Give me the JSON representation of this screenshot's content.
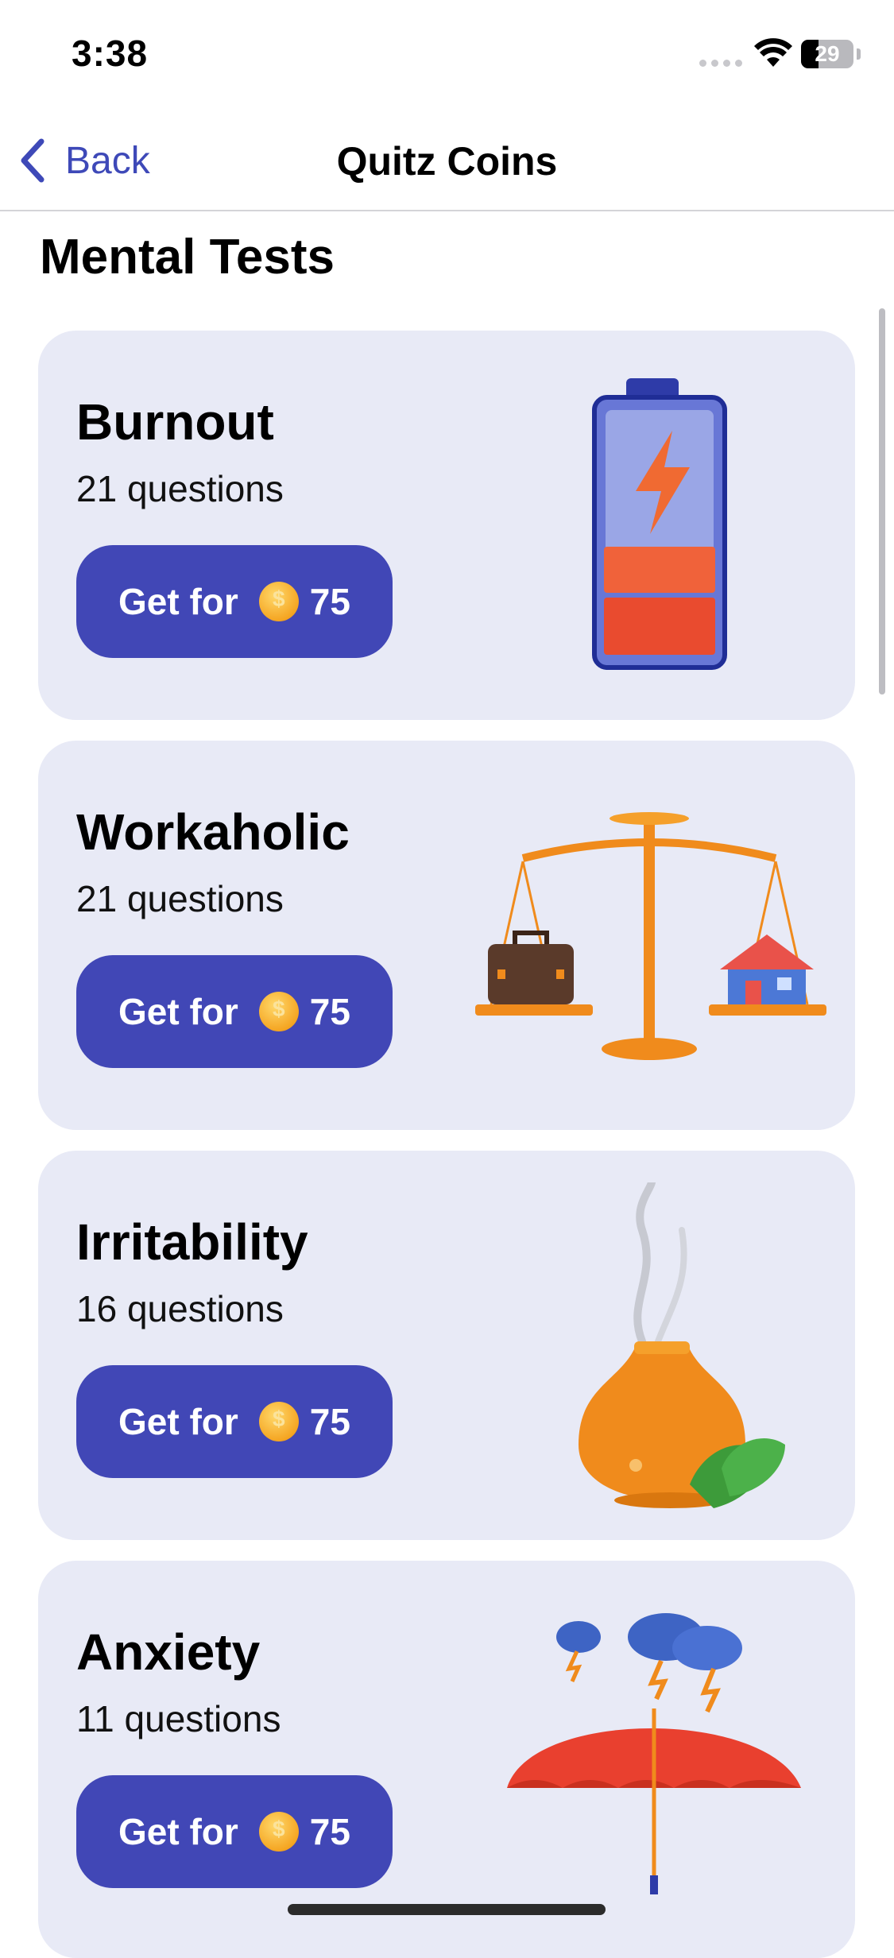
{
  "status_bar": {
    "time": "3:38",
    "battery_level": "29"
  },
  "nav": {
    "back_label": "Back",
    "title": "Quitz Coins"
  },
  "section": {
    "title": "Mental Tests"
  },
  "cards": [
    {
      "title": "Burnout",
      "questions": "21 questions",
      "button_prefix": "Get for",
      "price": "75",
      "illustration": "battery-charging-icon"
    },
    {
      "title": "Workaholic",
      "questions": "21 questions",
      "button_prefix": "Get for",
      "price": "75",
      "illustration": "balance-scale-icon"
    },
    {
      "title": "Irritability",
      "questions": "16 questions",
      "button_prefix": "Get for",
      "price": "75",
      "illustration": "aroma-diffuser-icon"
    },
    {
      "title": "Anxiety",
      "questions": "11 questions",
      "button_prefix": "Get for",
      "price": "75",
      "illustration": "umbrella-storm-icon"
    }
  ],
  "colors": {
    "accent": "#4147b6",
    "card_bg": "#e8eaf6",
    "link": "#3e49b8"
  }
}
